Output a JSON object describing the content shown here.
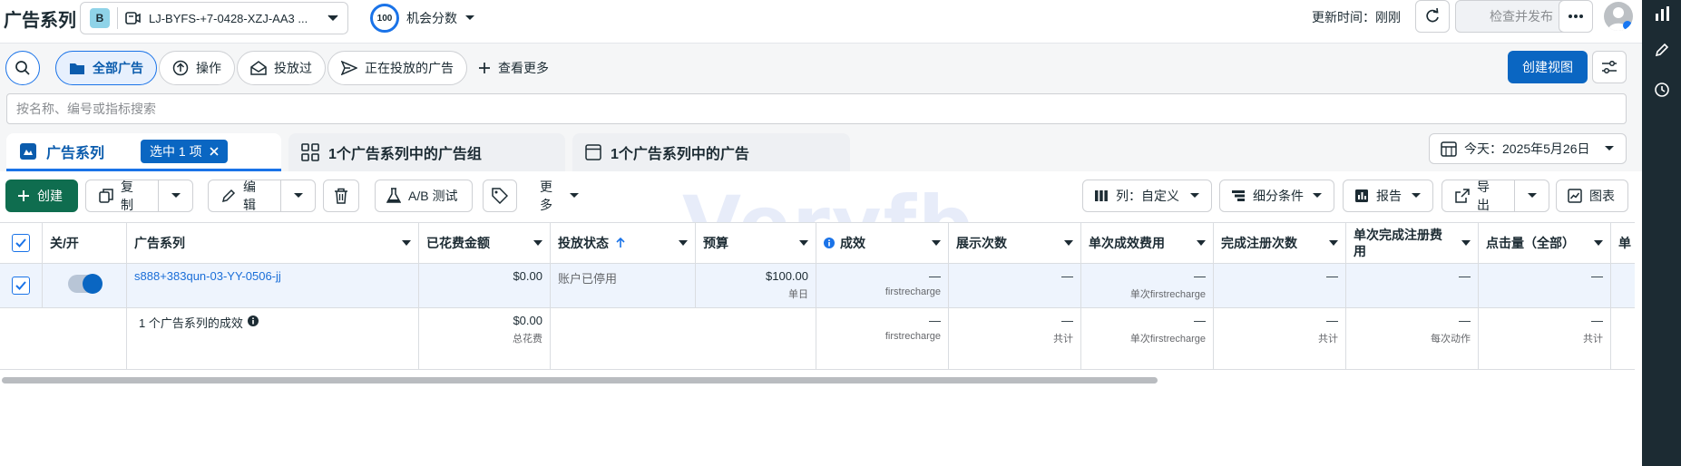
{
  "header": {
    "title": "广告系列",
    "account_badge": "B",
    "account_name": "LJ-BYFS-+7-0428-XZJ-AA3 ...",
    "score_value": "100",
    "score_label": "机会分数",
    "update_text": "更新时间：刚刚",
    "publish_label": "检查并发布"
  },
  "filters": {
    "chips": [
      {
        "label": "全部广告",
        "icon": "folder-icon"
      },
      {
        "label": "操作",
        "icon": "upload-icon"
      },
      {
        "label": "投放过",
        "icon": "inbox-icon"
      },
      {
        "label": "正在投放的广告",
        "icon": "send-icon"
      },
      {
        "label": "查看更多",
        "icon": "plus-icon"
      }
    ],
    "create_view_label": "创建视图"
  },
  "search": {
    "placeholder": "按名称、编号或指标搜索"
  },
  "level_tabs": {
    "campaigns": "广告系列",
    "selected": "选中 1 项",
    "adsets": "1个广告系列中的广告组",
    "ads": "1个广告系列中的广告"
  },
  "date_range": "今天：2025年5月26日",
  "toolbar": {
    "create": "创建",
    "copy": "复制",
    "edit": "编辑",
    "ab_test": "A/B 测试",
    "more": "更多",
    "columns": "列：自定义",
    "breakdown": "细分条件",
    "reports": "报告",
    "export": "导出",
    "chart": "图表"
  },
  "table": {
    "headers": [
      "关/开",
      "广告系列",
      "已花费金额",
      "投放状态",
      "预算",
      "成效",
      "展示次数",
      "单次成效费用",
      "完成注册次数",
      "单次完成注册费用",
      "点击量（全部）",
      "单"
    ],
    "rows": [
      {
        "name": "s888+383qun-03-YY-0506-jj",
        "spend": "$0.00",
        "status": "账户已停用",
        "budget": "$100.00",
        "budget_sub": "单日",
        "results": "—",
        "results_sub": "firstrecharge",
        "impressions": "—",
        "cpr": "—",
        "cpr_sub": "单次firstrecharge",
        "regs": "—",
        "cost_reg": "—",
        "clicks": "—"
      }
    ],
    "summary": {
      "label": "1 个广告系列的成效",
      "spend": "$0.00",
      "spend_sub": "总花费",
      "results": "—",
      "results_sub": "firstrecharge",
      "impressions": "—",
      "impressions_sub": "共计",
      "cpr": "—",
      "cpr_sub": "单次firstrecharge",
      "regs": "—",
      "regs_sub": "共计",
      "cost_reg": "—",
      "cost_reg_sub": "每次动作",
      "clicks": "—",
      "clicks_sub": "共计"
    }
  },
  "watermark": "Veryfb",
  "colors": {
    "primary": "#0a66c2",
    "create": "#0f6d4f",
    "rail": "#1c2b33"
  }
}
